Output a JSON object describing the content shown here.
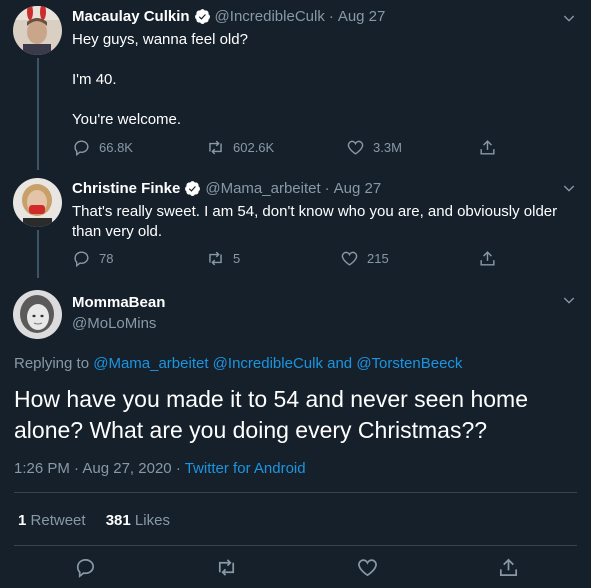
{
  "tweets": [
    {
      "name": "Macaulay Culkin",
      "handle": "@IncredibleCulk",
      "sep": "·",
      "date": "Aug 27",
      "lines": [
        "Hey guys, wanna feel old?",
        "I'm 40.",
        "You're welcome."
      ],
      "replies": "66.8K",
      "retweets": "602.6K",
      "likes": "3.3M"
    },
    {
      "name": "Christine Finke",
      "handle": "@Mama_arbeitet",
      "sep": "·",
      "date": "Aug 27",
      "lines": [
        "That's really sweet. I am 54, don't know who you are, and obviously older",
        "than very old."
      ],
      "replies": "78",
      "retweets": "5",
      "likes": "215"
    }
  ],
  "main": {
    "name": "MommaBean",
    "handle": "@MoLoMins",
    "replying_prefix": "Replying to",
    "replying_to": [
      "@Mama_arbeitet",
      "@IncredibleCulk",
      "and",
      "@TorstenBeeck"
    ],
    "text_lines": [
      "How have you made it to 54 and never seen home",
      "alone? What are you doing every Christmas??"
    ],
    "time": "1:26 PM",
    "sep": "·",
    "date": "Aug 27, 2020",
    "source_sep": "·",
    "source": "Twitter for Android",
    "retweet_count": "1",
    "retweet_label": "Retweet",
    "like_count": "381",
    "like_label": "Likes"
  },
  "colors": {
    "background": "#15202b",
    "muted": "#8899a6",
    "link": "#1b95e0",
    "divider": "#38444d",
    "verified": "#1da1f2"
  },
  "icons": [
    "reply-icon",
    "retweet-icon",
    "like-icon",
    "share-icon",
    "chevron-down-icon",
    "verified-badge-icon"
  ]
}
